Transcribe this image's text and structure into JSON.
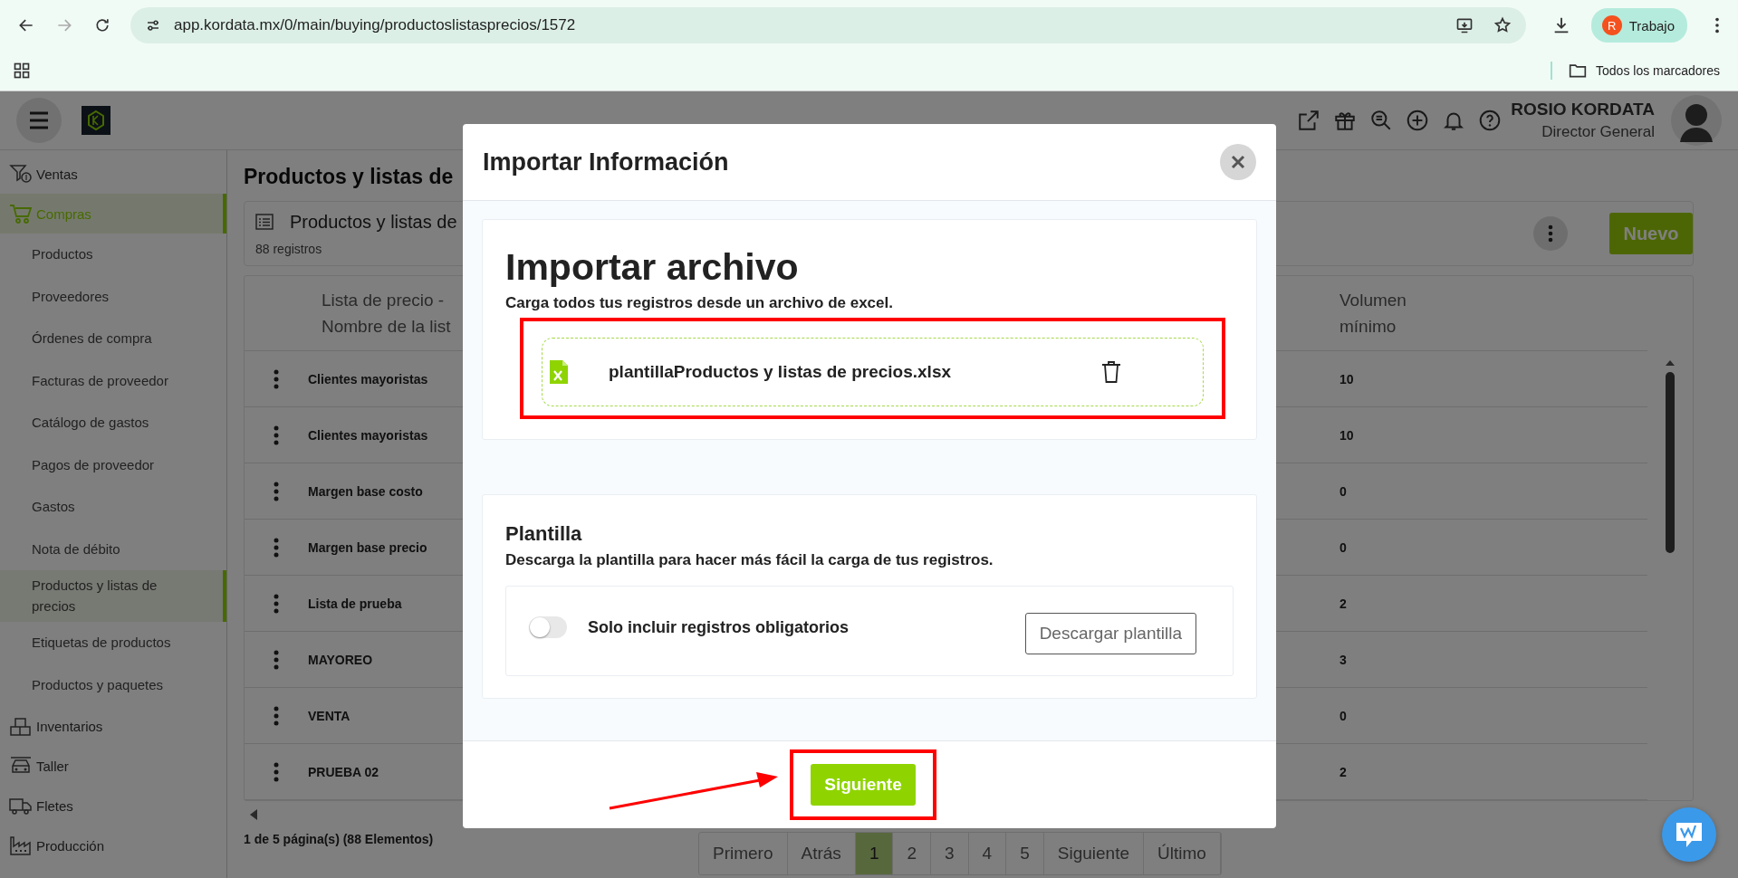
{
  "browser": {
    "url": "app.kordata.mx/0/main/buying/productoslistasprecios/1572",
    "profile_initial": "R",
    "profile_label": "Trabajo",
    "bookmarks_folder": "Todos los marcadores"
  },
  "header": {
    "user_name": "ROSIO KORDATA",
    "user_role": "Director General"
  },
  "sidebar": [
    {
      "label": "Ventas",
      "selected": false
    },
    {
      "label": "Compras",
      "selected": true,
      "children": [
        {
          "label": "Productos",
          "selected": false
        },
        {
          "label": "Proveedores",
          "selected": false
        },
        {
          "label": "Órdenes de compra",
          "selected": false
        },
        {
          "label": "Facturas de proveedor",
          "selected": false
        },
        {
          "label": "Catálogo de gastos",
          "selected": false
        },
        {
          "label": "Pagos de proveedor",
          "selected": false
        },
        {
          "label": "Gastos",
          "selected": false
        },
        {
          "label": "Nota de débito",
          "selected": false
        },
        {
          "label": "Productos y listas de precios",
          "selected": true
        },
        {
          "label": "Etiquetas de productos",
          "selected": false
        },
        {
          "label": "Productos y paquetes",
          "selected": false
        }
      ]
    },
    {
      "label": "Inventarios",
      "selected": false
    },
    {
      "label": "Taller",
      "selected": false
    },
    {
      "label": "Fletes",
      "selected": false
    },
    {
      "label": "Producción",
      "selected": false
    }
  ],
  "page": {
    "title": "Productos y listas de",
    "card_title": "Productos y listas de",
    "record_count": "88 registros",
    "new_button": "Nuevo"
  },
  "table": {
    "columns": [
      "Lista de precio - Nombre de la list",
      "Volumen mínimo"
    ],
    "rows": [
      {
        "name": "Clientes mayoristas",
        "volume": "10"
      },
      {
        "name": "Clientes mayoristas",
        "volume": "10"
      },
      {
        "name": "Margen base costo",
        "volume": "0"
      },
      {
        "name": "Margen base precio",
        "volume": "0"
      },
      {
        "name": "Lista de prueba",
        "volume": "2"
      },
      {
        "name": "MAYOREO",
        "volume": "3"
      },
      {
        "name": "VENTA",
        "volume": "0"
      },
      {
        "name": "PRUEBA 02",
        "volume": "2"
      }
    ]
  },
  "pagination": {
    "summary": "1 de 5 página(s) (88 Elementos)",
    "buttons": [
      {
        "label": "Primero",
        "selected": false
      },
      {
        "label": "Atrás",
        "selected": false
      },
      {
        "label": "1",
        "selected": true
      },
      {
        "label": "2",
        "selected": false
      },
      {
        "label": "3",
        "selected": false
      },
      {
        "label": "4",
        "selected": false
      },
      {
        "label": "5",
        "selected": false
      },
      {
        "label": "Siguiente",
        "selected": false
      },
      {
        "label": "Último",
        "selected": false
      }
    ]
  },
  "modal": {
    "title": "Importar Información",
    "import_heading": "Importar archivo",
    "import_description": "Carga todos tus registros desde un archivo de excel.",
    "file_name": "plantillaProductos y listas de precios.xlsx",
    "template_heading": "Plantilla",
    "template_description": "Descarga la plantilla para hacer más fácil la carga de tus registros.",
    "toggle": {
      "label": "Solo incluir registros obligatorios",
      "on": false
    },
    "download_button": "Descargar plantilla",
    "next_button": "Siguiente"
  }
}
